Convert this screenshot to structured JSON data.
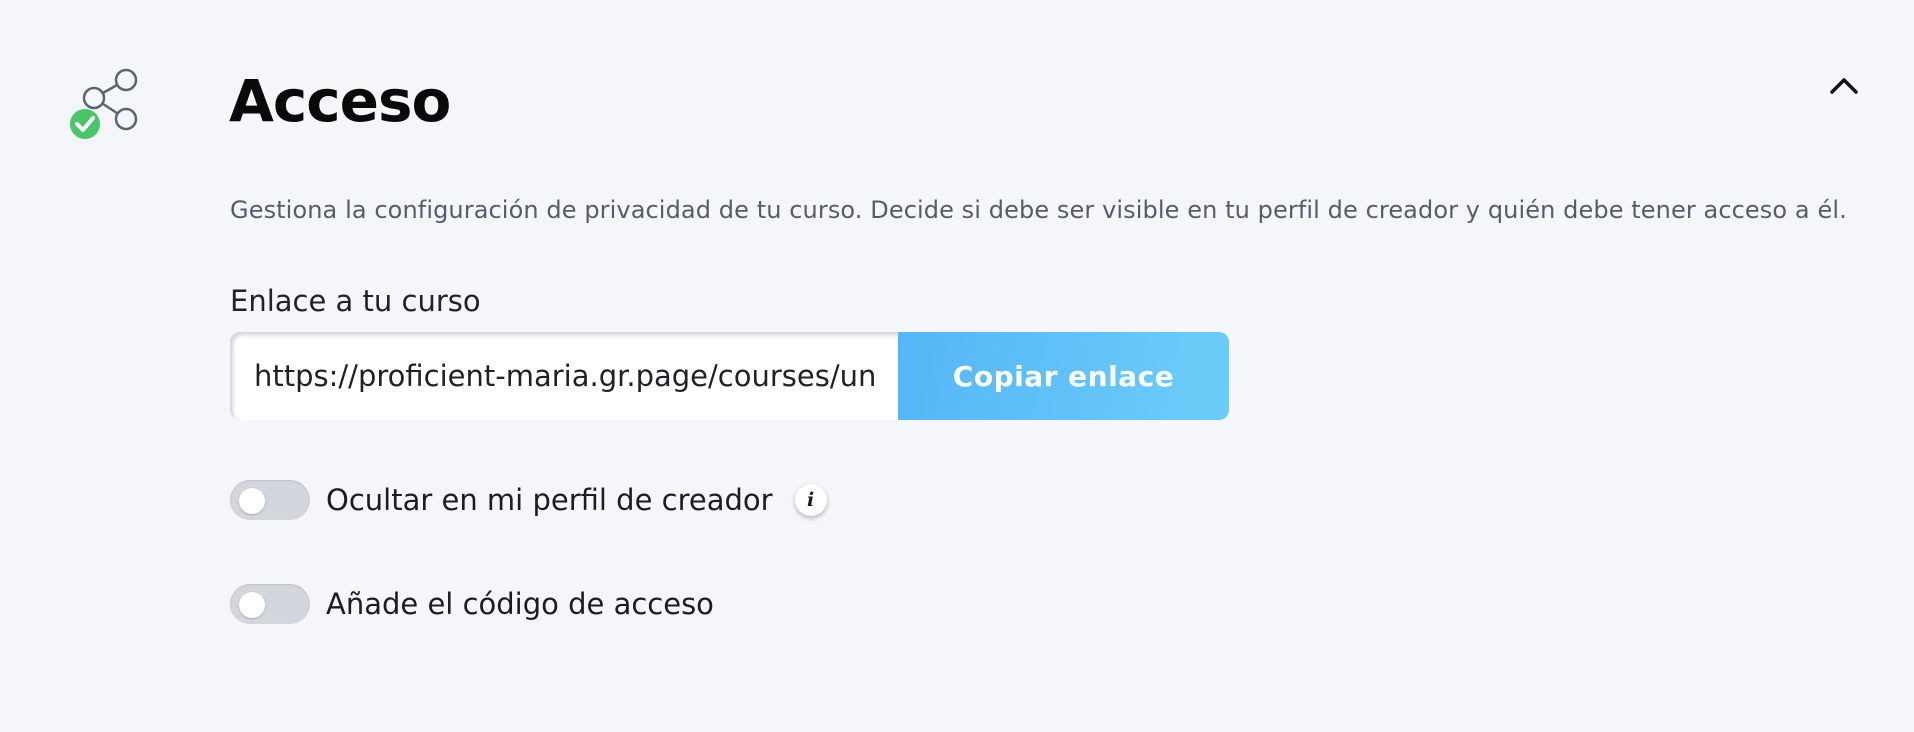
{
  "section": {
    "title": "Acceso",
    "description": "Gestiona la configuración de privacidad de tu curso. Decide si debe ser visible en tu perfil de creador y quién debe tener acceso a él.",
    "icon": "share-check-icon",
    "collapse_icon": "chevron-up-icon"
  },
  "course_link": {
    "label": "Enlace a tu curso",
    "value": "https://proficient-maria.gr.page/courses/unt",
    "copy_label": "Copiar enlace"
  },
  "toggles": [
    {
      "label": "Ocultar en mi perfil de creador",
      "enabled": false,
      "has_info": true
    },
    {
      "label": "Añade el código de acceso",
      "enabled": false,
      "has_info": false
    }
  ],
  "info_icon_glyph": "i",
  "colors": {
    "background": "#f5f6fa",
    "accent_blue": "#5ab9f7",
    "success_green": "#4cc46a",
    "toggle_off": "#d3d6dc"
  }
}
